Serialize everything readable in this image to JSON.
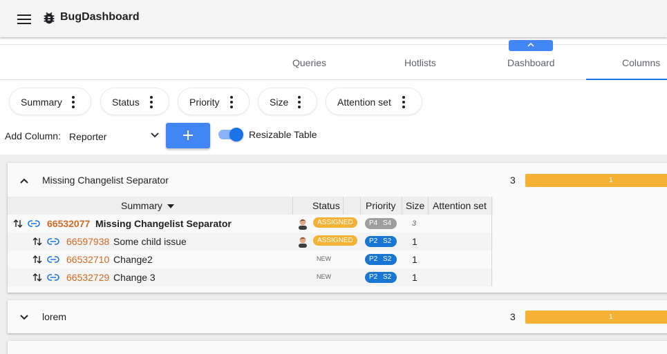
{
  "app": {
    "title": "BugDashboard"
  },
  "tabs": [
    {
      "label": "Queries"
    },
    {
      "label": "Hotlists"
    },
    {
      "label": "Dashboard"
    },
    {
      "label": "Columns",
      "active": true
    }
  ],
  "columns": [
    {
      "label": "Summary"
    },
    {
      "label": "Status"
    },
    {
      "label": "Priority"
    },
    {
      "label": "Size"
    },
    {
      "label": "Attention set"
    }
  ],
  "controls": {
    "add_column_label": "Add Column:",
    "add_column_value": "Reporter",
    "resizable_label": "Resizable Table",
    "resizable_on": true
  },
  "groups": [
    {
      "title": "Missing Changelist Separator",
      "expanded": true,
      "count": "3",
      "bar_value": "1",
      "table": {
        "headers": {
          "summary": "Summary",
          "status": "Status",
          "priority": "Priority",
          "size": "Size",
          "attention": "Attention set"
        },
        "rows": [
          {
            "id": "66532077",
            "summary": "Missing Changelist Separator",
            "status": "ASSIGNED",
            "priority": "P4",
            "severity": "S4",
            "size": "3"
          },
          {
            "id": "66597938",
            "summary": "Some child issue",
            "status": "ASSIGNED",
            "priority": "P2",
            "severity": "S2",
            "size": "1"
          },
          {
            "id": "66532710",
            "summary": "Change2",
            "status": "NEW",
            "priority": "P2",
            "severity": "S2",
            "size": "1"
          },
          {
            "id": "66532729",
            "summary": "Change 3",
            "status": "NEW",
            "priority": "P2",
            "severity": "S2",
            "size": "1"
          }
        ]
      }
    },
    {
      "title": "lorem",
      "expanded": false,
      "count": "3",
      "bar_value": "1"
    }
  ],
  "colors": {
    "accent": "#4285f4",
    "bar": "#f4b133",
    "bug_id": "#d2691e",
    "priority_blue": "#1976d2",
    "priority_grey": "#9e9e9e"
  }
}
